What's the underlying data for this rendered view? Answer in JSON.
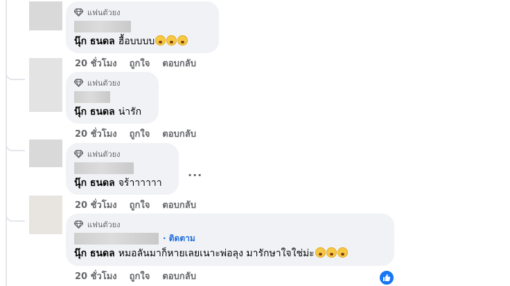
{
  "badge_label": "แฟนตัวยง",
  "comments": [
    {
      "author": "นุ๊ก ธนดล",
      "text": "ฮื้อบบบบ",
      "emoji_count": 3,
      "time": "20 ชั่วโมง",
      "like": "ถูกใจ",
      "reply": "ตอบกลับ"
    },
    {
      "author": "นุ๊ก ธนดล",
      "text": "น่ารัก",
      "emoji_count": 0,
      "time": "20 ชั่วโมง",
      "like": "ถูกใจ",
      "reply": "ตอบกลับ"
    },
    {
      "author": "นุ๊ก ธนดล",
      "text": "จร้าาาาาา",
      "emoji_count": 0,
      "time": "20 ชั่วโมง",
      "like": "ถูกใจ",
      "reply": "ตอบกลับ"
    },
    {
      "author": "นุ๊ก ธนดล",
      "text": "หมอลันมาก็หายเลยเนาะพ่อลุง มารักษาใจใช่ม่ะ",
      "emoji_count": 3,
      "time": "20 ชั่วโมง",
      "like": "ถูกใจ",
      "reply": "ตอบกลับ",
      "follow": "· ติดตาม"
    }
  ],
  "more_label": "...",
  "colors": {
    "bubble": "#f0f2f5",
    "meta": "#65676b",
    "link": "#216fdb",
    "like": "#1877f2"
  },
  "icons": {
    "badge": "diamond-icon",
    "reaction": "like-icon",
    "emoji": "astonished-emoji"
  }
}
